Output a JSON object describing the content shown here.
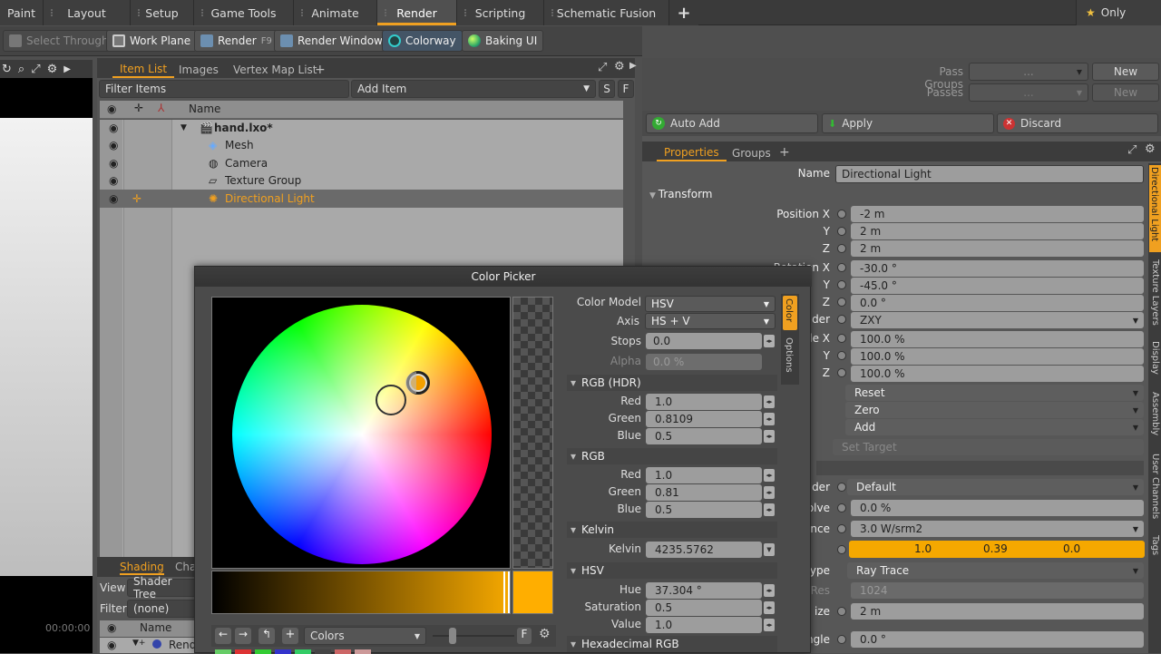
{
  "tabs": [
    {
      "label": "Paint"
    },
    {
      "label": "Layout"
    },
    {
      "label": "Setup"
    },
    {
      "label": "Game Tools"
    },
    {
      "label": "Animate"
    },
    {
      "label": "Render"
    },
    {
      "label": "Scripting"
    },
    {
      "label": "Schematic Fusion"
    }
  ],
  "tabs_add": "+",
  "only_label": "Only",
  "toolbar": {
    "select_through": "Select Through",
    "work_plane": "Work Plane",
    "render": "Render",
    "render_key": "F9",
    "render_window": "Render Window",
    "colorway": "Colorway",
    "baking_ui": "Baking UI"
  },
  "itemlist": {
    "tab_item": "Item List",
    "tab_images": "Images",
    "tab_vmap": "Vertex Map List",
    "tab_add": "+",
    "filter": "Filter Items",
    "add_item": "Add Item",
    "s": "S",
    "f": "F",
    "col_name": "Name",
    "rows": [
      {
        "label": "hand.lxo*"
      },
      {
        "label": "Mesh"
      },
      {
        "label": "Camera"
      },
      {
        "label": "Texture Group"
      },
      {
        "label": "Directional Light"
      }
    ]
  },
  "shading": {
    "tab1": "Shading",
    "tab2": "Cha",
    "view_label": "View",
    "view_value": "Shader Tree",
    "filter_label": "Filter",
    "filter_value": "(none)",
    "col_name": "Name",
    "row1": "Rend",
    "time": "00:00:00"
  },
  "passes": {
    "pass_groups": "Pass Groups",
    "passes": "Passes",
    "dots": "...",
    "new1": "New",
    "new2": "New"
  },
  "actions": {
    "auto_add": "Auto Add",
    "apply": "Apply",
    "discard": "Discard"
  },
  "props": {
    "tab_properties": "Properties",
    "tab_groups": "Groups",
    "tab_add": "+",
    "name_label": "Name",
    "name_value": "Directional Light",
    "transform": "Transform",
    "pos_x_label": "Position X",
    "pos_y_label": "Y",
    "pos_z_label": "Z",
    "pos_x": "-2 m",
    "pos_y": "2 m",
    "pos_z": "2 m",
    "rot_x_label": "Rotation X",
    "rot_y_label": "Y",
    "rot_z_label": "Z",
    "rot_x": "-30.0 °",
    "rot_y": "-45.0 °",
    "rot_z": "0.0 °",
    "order_label": "der",
    "order_value": "ZXY",
    "scale_x_label": "le X",
    "scale_y_label": "Y",
    "scale_z_label": "Z",
    "scale_x": "100.0 %",
    "scale_y": "100.0 %",
    "scale_z": "100.0 %",
    "reset": "Reset",
    "zero": "Zero",
    "add": "Add",
    "set_target": "Set Target",
    "render_label": "der",
    "render_value": "Default",
    "dissolve_label": "olve",
    "dissolve_value": "0.0 %",
    "radiance_label": "nce",
    "radiance_value": "3.0 W/srm2",
    "color_r": "1.0",
    "color_g": "0.39",
    "color_b": "0.0",
    "type_label": "ype",
    "type_value": "Ray Trace",
    "res_label": "Res",
    "res_value": "1024",
    "size_label": "ize",
    "size_value": "2 m",
    "angle_label": "ngle",
    "angle_value": "0.0 °",
    "side_tabs": [
      "Directional Light",
      "Texture Layers",
      "Display",
      "Assembly",
      "User Channels",
      "Tags"
    ]
  },
  "picker": {
    "title": "Color Picker",
    "color_model_label": "Color Model",
    "color_model": "HSV",
    "axis_label": "Axis",
    "axis": "HS + V",
    "stops_label": "Stops",
    "stops": "0.0",
    "alpha_label": "Alpha",
    "alpha": "0.0 %",
    "rgb_hdr": "RGB (HDR)",
    "red_label": "Red",
    "green_label": "Green",
    "blue_label": "Blue",
    "hdr_red": "1.0",
    "hdr_green": "0.8109",
    "hdr_blue": "0.5",
    "rgb": "RGB",
    "rgb_red": "1.0",
    "rgb_green": "0.81",
    "rgb_blue": "0.5",
    "kelvin_sect": "Kelvin",
    "kelvin_label": "Kelvin",
    "kelvin": "4235.5762",
    "hsv": "HSV",
    "hue_label": "Hue",
    "hue": "37.304 °",
    "sat_label": "Saturation",
    "sat": "0.5",
    "value_label": "Value",
    "value": "1.0",
    "hex": "Hexadecimal RGB",
    "side_color": "Color",
    "side_options": "Options",
    "colors_dd": "Colors",
    "f": "F"
  },
  "colors": {
    "accent": "#f0a020",
    "swatch": "#ffae00"
  }
}
